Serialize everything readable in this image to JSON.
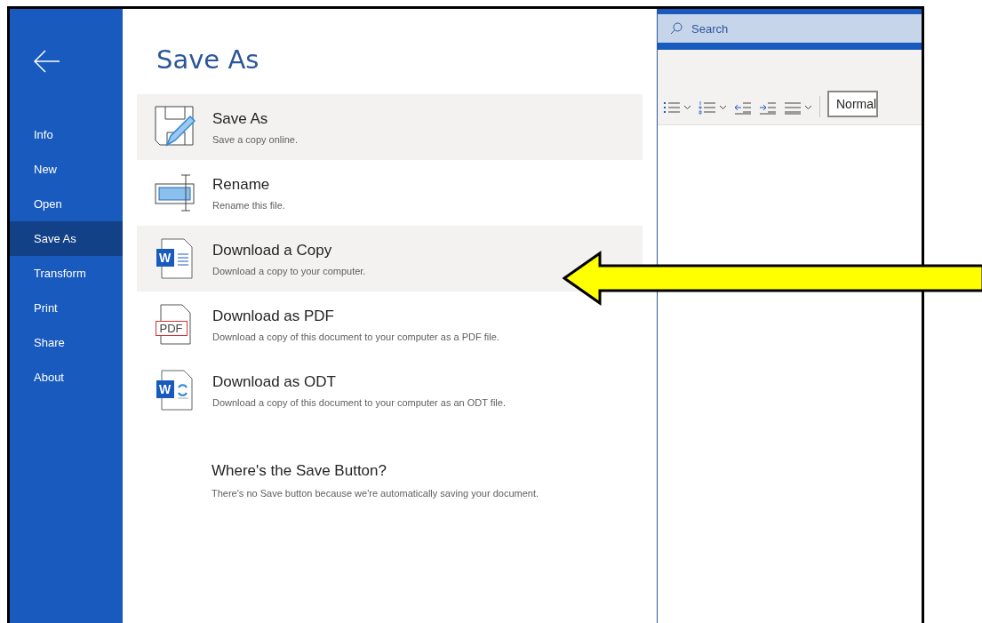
{
  "sidebar": {
    "items": [
      {
        "label": "Info",
        "selected": false
      },
      {
        "label": "New",
        "selected": false
      },
      {
        "label": "Open",
        "selected": false
      },
      {
        "label": "Save As",
        "selected": true
      },
      {
        "label": "Transform",
        "selected": false
      },
      {
        "label": "Print",
        "selected": false
      },
      {
        "label": "Share",
        "selected": false
      },
      {
        "label": "About",
        "selected": false
      }
    ]
  },
  "panel": {
    "title": "Save As",
    "options": [
      {
        "kind": "save",
        "title": "Save As",
        "description": "Save a copy online.",
        "highlighted": true
      },
      {
        "kind": "rename",
        "title": "Rename",
        "description": "Rename this file.",
        "highlighted": false
      },
      {
        "kind": "word",
        "badge": "W",
        "title": "Download a Copy",
        "description": "Download a copy to your computer.",
        "highlighted": true
      },
      {
        "kind": "pdf",
        "badge": "PDF",
        "title": "Download as PDF",
        "description": "Download a copy of this document to your computer as a PDF file.",
        "highlighted": false
      },
      {
        "kind": "odt",
        "badge": "W",
        "title": "Download as ODT",
        "description": "Download a copy of this document to your computer as an ODT file.",
        "highlighted": false
      }
    ],
    "note": {
      "title": "Where's the Save Button?",
      "text": "There's no Save button because we're automatically saving your document."
    }
  },
  "document": {
    "search": {
      "placeholder": "Search"
    },
    "style_box": {
      "value": "Normal"
    }
  }
}
